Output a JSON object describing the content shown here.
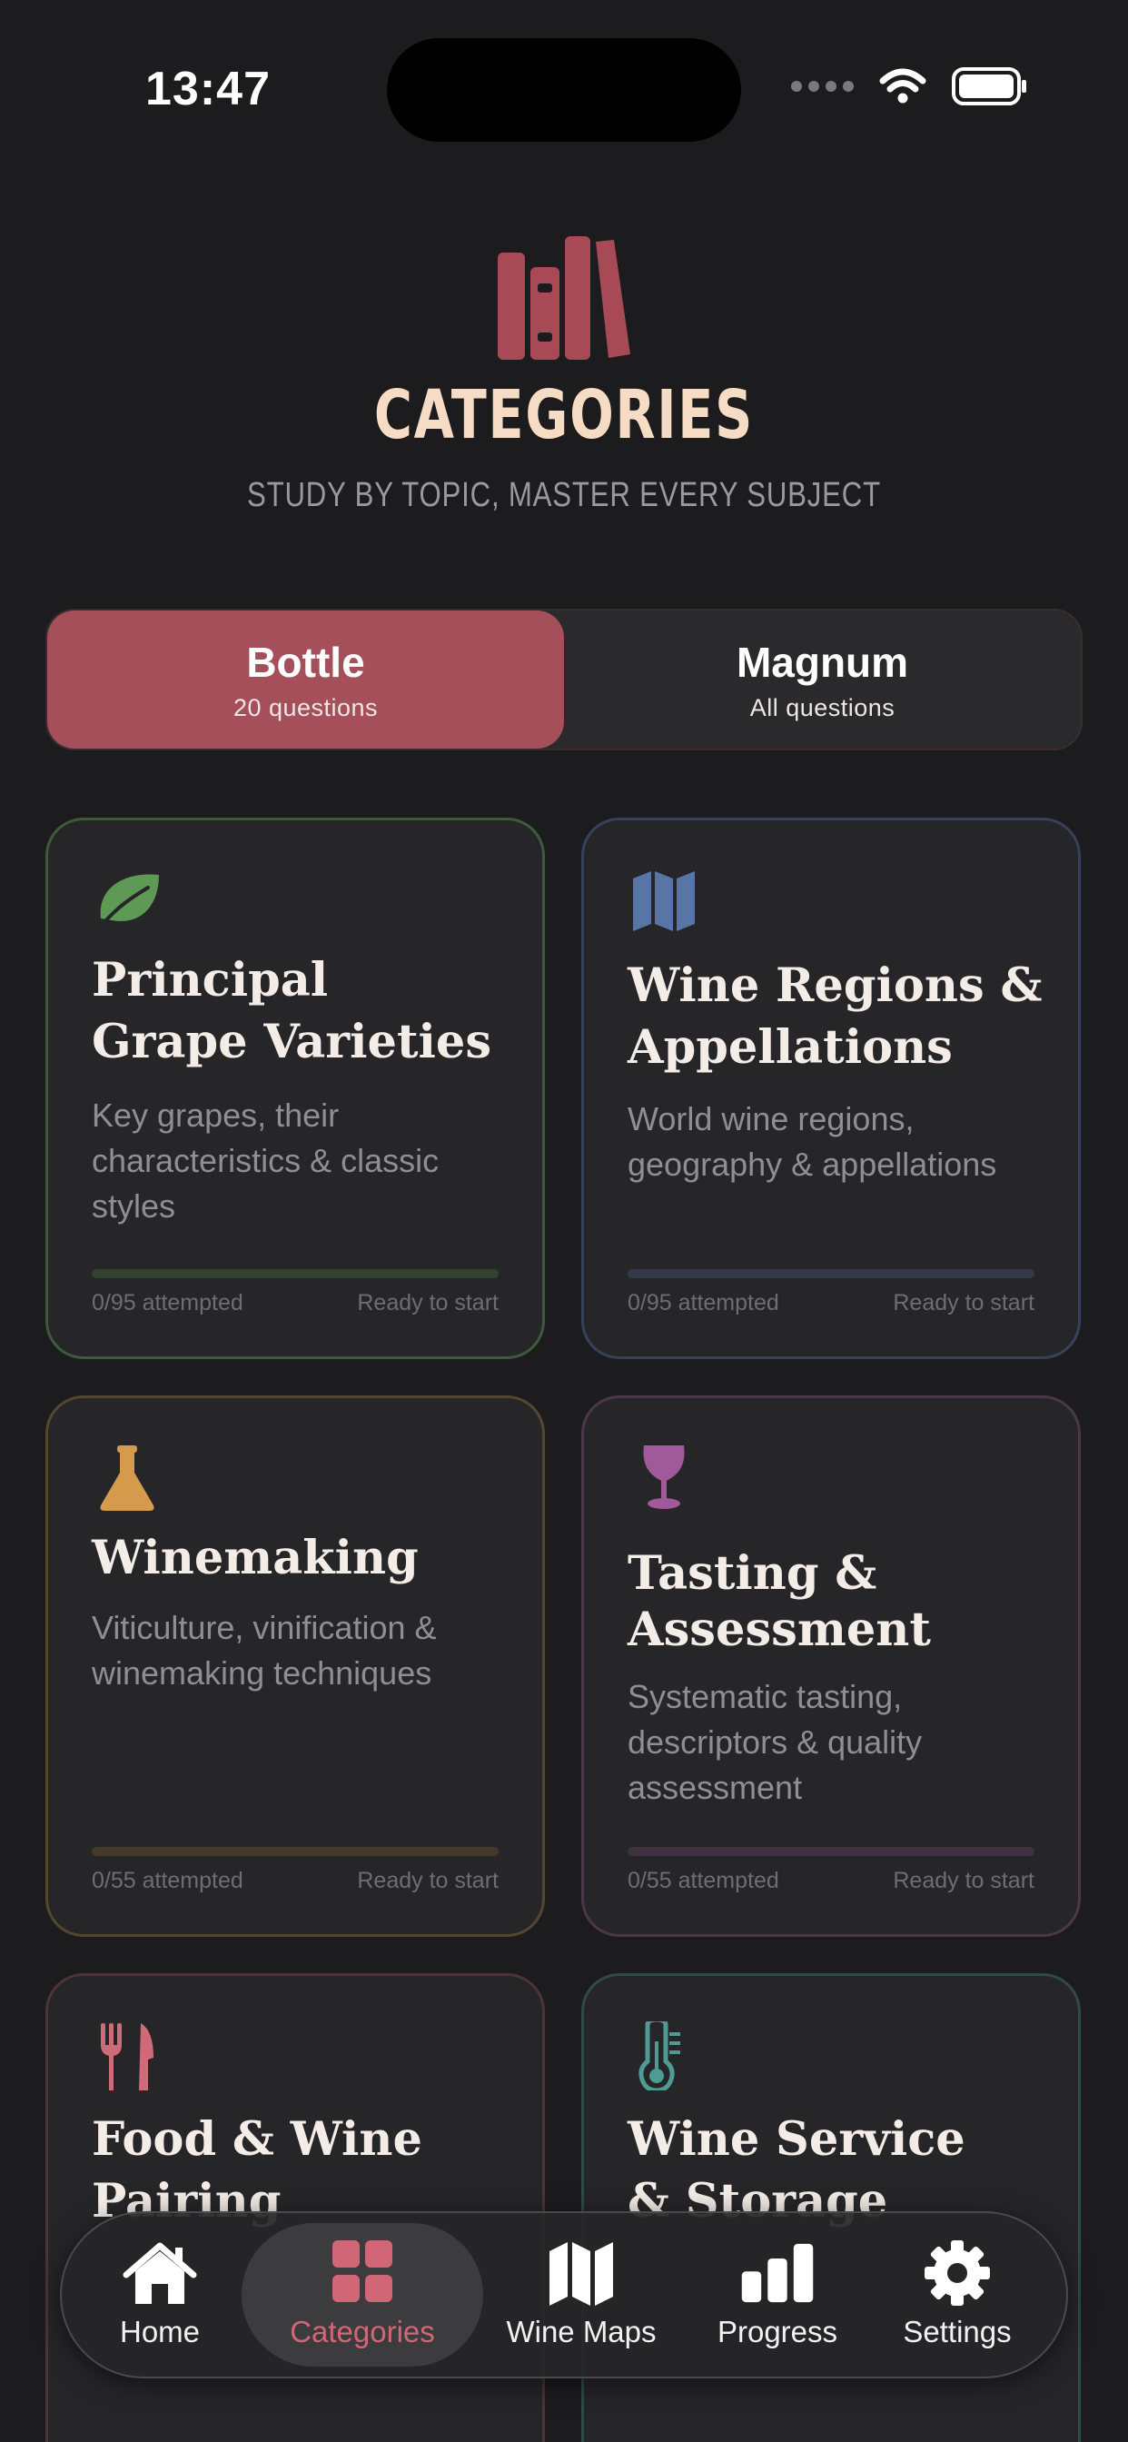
{
  "status_bar": {
    "time": "13:47"
  },
  "header": {
    "title": "CATEGORIES",
    "subtitle": "STUDY BY TOPIC, MASTER EVERY SUBJECT"
  },
  "mode_toggle": {
    "options": [
      {
        "label": "Bottle",
        "sub": "20 questions",
        "selected": true
      },
      {
        "label": "Magnum",
        "sub": "All questions",
        "selected": false
      }
    ]
  },
  "categories": [
    {
      "icon": "leaf-icon",
      "color": "#5e9a55",
      "title": "Principal Grape Varieties",
      "title_line1": "Principal",
      "title_line2": "Grape Varieties",
      "description": "Key grapes, their characteristics & classic styles",
      "attempted": "0/95 attempted",
      "status": "Ready to start",
      "progress": 0
    },
    {
      "icon": "map-icon",
      "color": "#5875a6",
      "title": "Wine Regions & Appellations",
      "title_line1": "Wine Regions &",
      "title_line2": "Appellations",
      "description": "World wine regions, geography & appellations",
      "attempted": "0/95 attempted",
      "status": "Ready to start",
      "progress": 0
    },
    {
      "icon": "flask-icon",
      "color": "#d59a4c",
      "title": "Winemaking",
      "title_line1": "Winemaking",
      "title_line2": "",
      "description": "Viticulture, vinification & winemaking techniques",
      "attempted": "0/55 attempted",
      "status": "Ready to start",
      "progress": 0
    },
    {
      "icon": "wine-glass-icon",
      "color": "#a05a9a",
      "title": "Tasting & Assessment",
      "title_line1": "Tasting &",
      "title_line2": "Assessment",
      "description": "Systematic tasting, descriptors & quality assessment",
      "attempted": "0/55 attempted",
      "status": "Ready to start",
      "progress": 0
    },
    {
      "icon": "fork-knife-icon",
      "color": "#cf6a79",
      "title": "Food & Wine Pairing",
      "title_line1": "Food & Wine",
      "title_line2": "Pairing",
      "description": "",
      "attempted": "",
      "status": "",
      "progress": 0
    },
    {
      "icon": "thermometer-icon",
      "color": "#4f9a93",
      "title": "Wine Service & Storage",
      "title_line1": "Wine Service",
      "title_line2": "& Storage",
      "description": "",
      "attempted": "",
      "status": "",
      "progress": 0
    }
  ],
  "tab_bar": {
    "tabs": [
      {
        "label": "Home",
        "icon": "house-icon",
        "active": false
      },
      {
        "label": "Categories",
        "icon": "grid-icon",
        "active": true
      },
      {
        "label": "Wine Maps",
        "icon": "map-icon",
        "active": false
      },
      {
        "label": "Progress",
        "icon": "bar-chart-icon",
        "active": false
      },
      {
        "label": "Settings",
        "icon": "gear-icon",
        "active": false
      }
    ]
  },
  "colors": {
    "accent": "#a54f5b",
    "active_tab": "#d06676",
    "title": "#f6dcc4",
    "background": "#1c1c1e"
  }
}
